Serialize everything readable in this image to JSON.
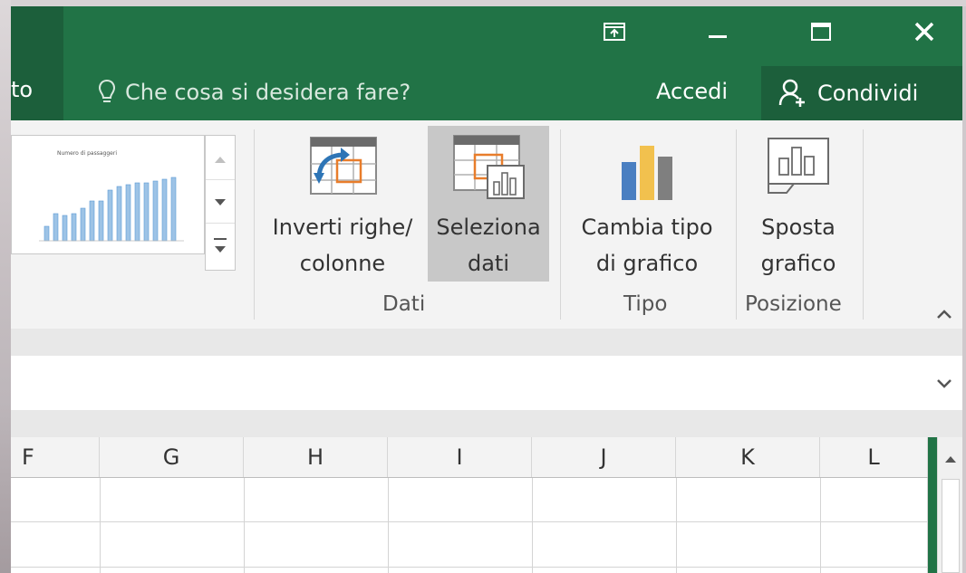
{
  "window": {
    "titlebar_buttons": [
      "ribbon-display-icon",
      "minimize-icon",
      "maximize-icon",
      "close-icon"
    ]
  },
  "tabs": {
    "partial_tab_label": "to",
    "tell_me_placeholder": "Che cosa si desidera fare?",
    "signin_label": "Accedi",
    "share_label": "Condividi"
  },
  "ribbon": {
    "buttons": {
      "switch_row_col": {
        "line1": "Inverti righe/",
        "line2": "colonne"
      },
      "select_data": {
        "line1": "Seleziona",
        "line2": "dati"
      },
      "change_type": {
        "line1": "Cambia tipo",
        "line2": "di grafico"
      },
      "move_chart": {
        "line1": "Sposta",
        "line2": "grafico"
      }
    },
    "groups": {
      "dati": "Dati",
      "tipo": "Tipo",
      "posizione": "Posizione"
    },
    "chart_style_preview_title": "Numero di passaggeri"
  },
  "grid": {
    "columns": [
      "F",
      "G",
      "H",
      "I",
      "J",
      "K",
      "L"
    ]
  },
  "colors": {
    "excel_green": "#217346",
    "dark_green": "#1c5f3b",
    "ribbon_bg": "#f3f3f3",
    "selected_button": "#c8c8c8",
    "chart_blue": "#4a7fc1",
    "chart_yellow": "#f2c14e",
    "chart_gray": "#7f7f7f"
  }
}
